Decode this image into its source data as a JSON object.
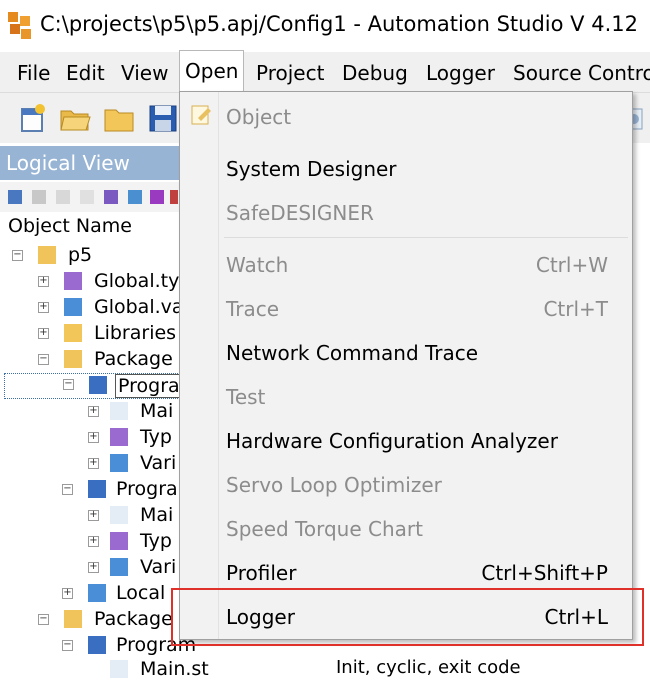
{
  "window": {
    "title": "C:\\projects\\p5\\p5.apj/Config1 - Automation Studio V 4.12"
  },
  "menubar": {
    "items": [
      {
        "label": "File"
      },
      {
        "label": "Edit"
      },
      {
        "label": "View"
      },
      {
        "label": "Open"
      },
      {
        "label": "Project"
      },
      {
        "label": "Debug"
      },
      {
        "label": "Logger"
      },
      {
        "label": "Source Contro"
      }
    ]
  },
  "toolbar": {
    "icons": [
      "new-project-icon",
      "open-folder-icon",
      "folder-icon",
      "save-icon"
    ]
  },
  "logical_view": {
    "title": "Logical View",
    "column_header": "Object Name",
    "tree": [
      {
        "label": "p5"
      },
      {
        "label": "Global.ty"
      },
      {
        "label": "Global.va"
      },
      {
        "label": "Libraries"
      },
      {
        "label": "Package"
      },
      {
        "label": "Progra"
      },
      {
        "label": "Mai"
      },
      {
        "label": "Typ"
      },
      {
        "label": "Vari"
      },
      {
        "label": "Progra"
      },
      {
        "label": "Mai"
      },
      {
        "label": "Typ"
      },
      {
        "label": "Vari"
      },
      {
        "label": "Local"
      },
      {
        "label": "Package"
      },
      {
        "label": "Program"
      },
      {
        "label": "Main.st"
      }
    ],
    "bottom_row_text": "Init, cyclic, exit code"
  },
  "open_menu": {
    "items": [
      {
        "label": "Object",
        "shortcut": "",
        "enabled": false
      },
      {
        "label": "System Designer",
        "shortcut": "",
        "enabled": true
      },
      {
        "label": "SafeDESIGNER",
        "shortcut": "",
        "enabled": false
      },
      {
        "label": "Watch",
        "shortcut": "Ctrl+W",
        "enabled": false
      },
      {
        "label": "Trace",
        "shortcut": "Ctrl+T",
        "enabled": false
      },
      {
        "label": "Network Command Trace",
        "shortcut": "",
        "enabled": true
      },
      {
        "label": "Test",
        "shortcut": "",
        "enabled": false
      },
      {
        "label": "Hardware Configuration Analyzer",
        "shortcut": "",
        "enabled": true
      },
      {
        "label": "Servo Loop Optimizer",
        "shortcut": "",
        "enabled": false
      },
      {
        "label": "Speed Torque Chart",
        "shortcut": "",
        "enabled": false
      },
      {
        "label": "Profiler",
        "shortcut": "Ctrl+Shift+P",
        "enabled": true
      },
      {
        "label": "Logger",
        "shortcut": "Ctrl+L",
        "enabled": true
      }
    ]
  },
  "colors": {
    "highlight": "#e0302a",
    "panel_header": "#98b4d4",
    "disabled_text": "#8c8c8c"
  }
}
